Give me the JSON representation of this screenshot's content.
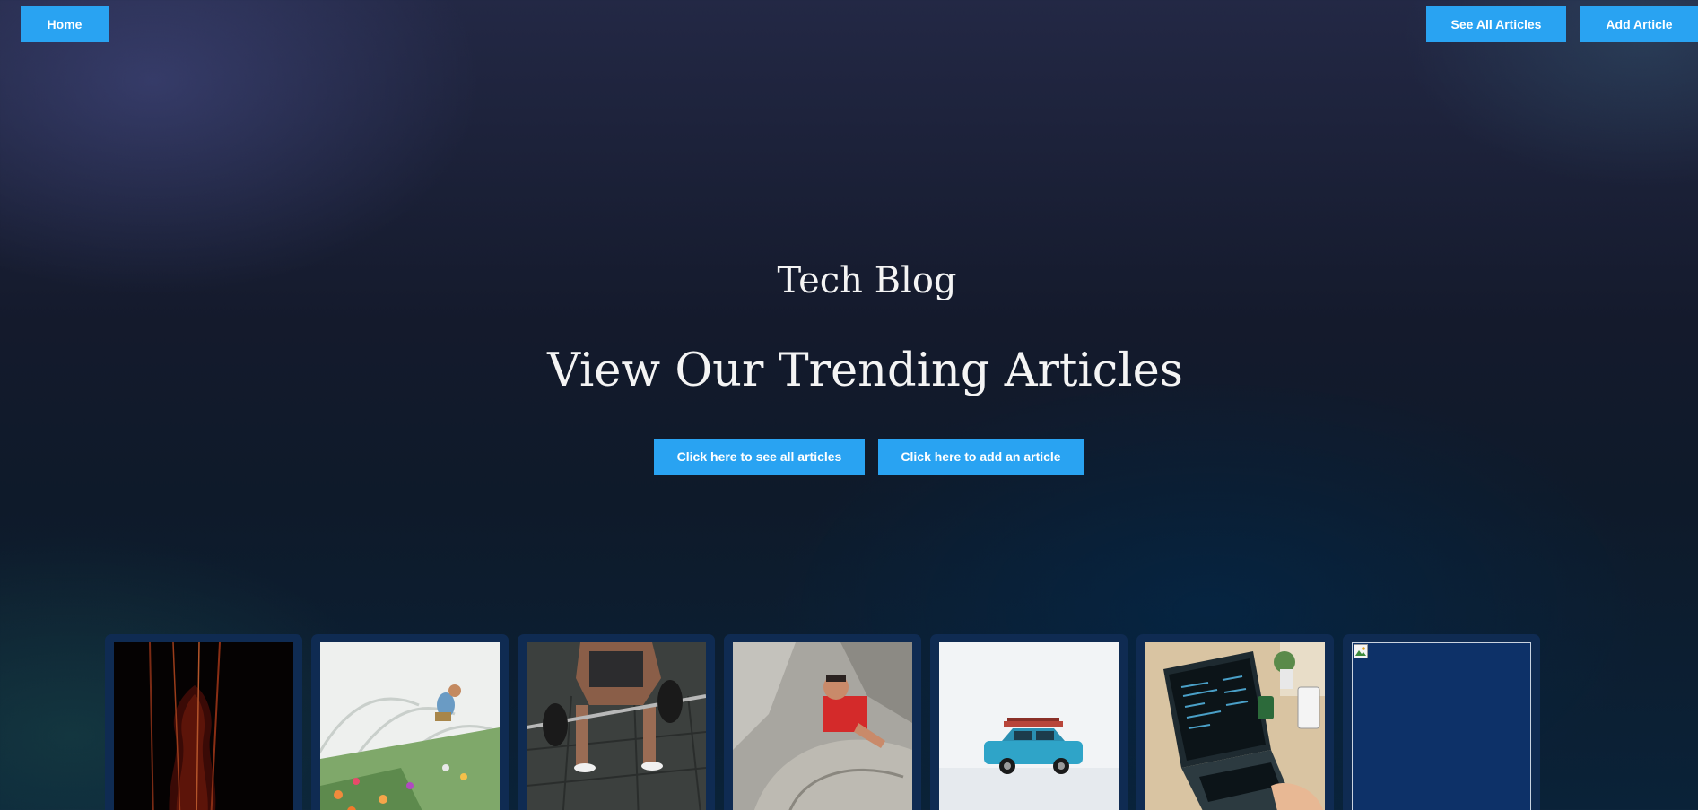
{
  "nav": {
    "home_label": "Home",
    "see_all_label": "See All Articles",
    "add_label": "Add Article"
  },
  "hero": {
    "site_title": "Tech Blog",
    "headline": "View Our Trending Articles",
    "cta_all_label": "Click here to see all articles",
    "cta_add_label": "Click here to add an article"
  },
  "colors": {
    "accent": "#29a3f2",
    "card_background": "#0f2b52"
  },
  "articles": [
    {
      "image": "violin"
    },
    {
      "image": "greenhouse-flowers"
    },
    {
      "image": "barbell-lift"
    },
    {
      "image": "rock-climber"
    },
    {
      "image": "blue-car-snow"
    },
    {
      "image": "laptop-desk"
    },
    {
      "image": "broken-image"
    }
  ]
}
